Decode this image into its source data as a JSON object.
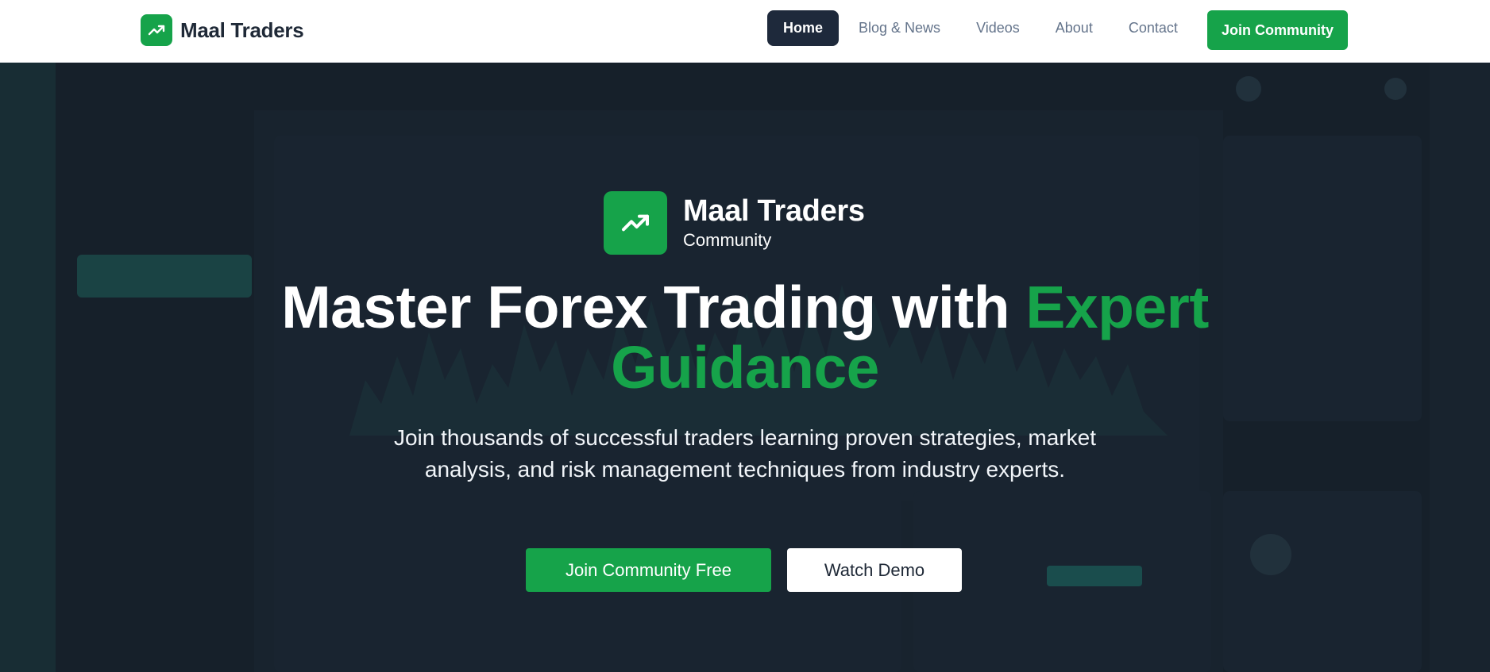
{
  "nav": {
    "brand": "Maal Traders",
    "links": [
      "Home",
      "Blog & News",
      "Videos",
      "About",
      "Contact"
    ],
    "active": "Home",
    "cta": "Join Community"
  },
  "hero": {
    "logo_name": "Maal Traders",
    "logo_sub": "Community",
    "headline_main": "Master Forex Trading with",
    "headline_accent_1": "Expert",
    "headline_accent_2": "Guidance",
    "subtitle": "Join thousands of successful traders learning proven strategies, market analysis, and risk management techniques from industry experts.",
    "primary_button": "Join Community Free",
    "secondary_button": "Watch Demo"
  },
  "colors": {
    "brand_green": "#16a34a",
    "nav_active": "#1e293b",
    "hero_bg": "#1b2733"
  },
  "icons": {
    "brand": "trending-up-icon"
  }
}
